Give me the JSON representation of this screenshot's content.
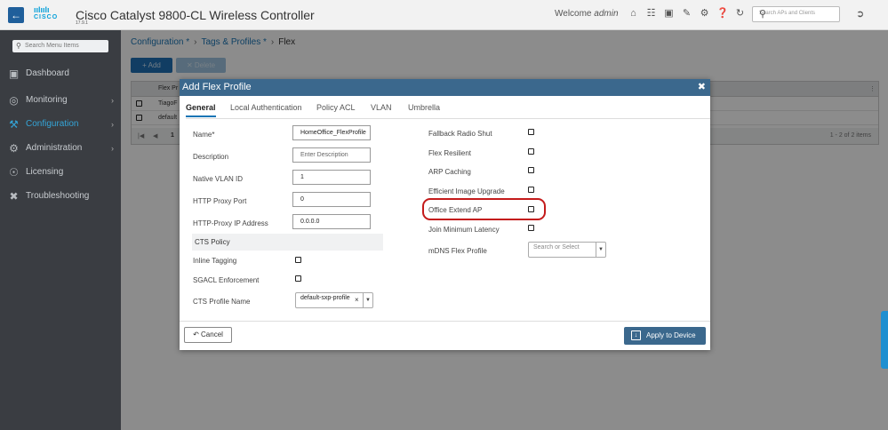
{
  "header": {
    "app_title": "Cisco Catalyst 9800-CL Wireless Controller",
    "version": "17.9.1",
    "logo_word": "CISCO",
    "welcome_prefix": "Welcome",
    "user": "admin",
    "search_placeholder": "Search APs and Clients",
    "icons": [
      "home-icon",
      "wireless-icon",
      "save-icon",
      "config-icon",
      "tools-icon",
      "help-icon",
      "refresh-icon"
    ]
  },
  "sidebar": {
    "search_placeholder": "Search Menu Items",
    "items": [
      {
        "label": "Dashboard",
        "icon": "dashboard-icon",
        "has_chevron": false,
        "active": false
      },
      {
        "label": "Monitoring",
        "icon": "monitoring-icon",
        "has_chevron": true,
        "active": false
      },
      {
        "label": "Configuration",
        "icon": "configuration-icon",
        "has_chevron": true,
        "active": true
      },
      {
        "label": "Administration",
        "icon": "administration-icon",
        "has_chevron": true,
        "active": false
      },
      {
        "label": "Licensing",
        "icon": "licensing-icon",
        "has_chevron": false,
        "active": false
      },
      {
        "label": "Troubleshooting",
        "icon": "troubleshooting-icon",
        "has_chevron": false,
        "active": false
      }
    ]
  },
  "breadcrumb": {
    "items": [
      "Configuration *",
      "Tags & Profiles *"
    ],
    "current": "Flex"
  },
  "toolbar": {
    "add_label": "Add",
    "delete_label": "Delete"
  },
  "grid": {
    "column_header": "Flex Pr",
    "rows": [
      "TiagoF",
      "default"
    ],
    "page_number": "1",
    "items_text": "1 - 2 of 2 items"
  },
  "modal": {
    "title": "Add Flex Profile",
    "tabs": [
      "General",
      "Local Authentication",
      "Policy ACL",
      "VLAN",
      "Umbrella"
    ],
    "active_tab": "General",
    "fields": {
      "name_label": "Name*",
      "name_value": "HomeOffice_FlexProfile",
      "description_label": "Description",
      "description_placeholder": "Enter Description",
      "native_vlan_label": "Native VLAN ID",
      "native_vlan_value": "1",
      "http_proxy_port_label": "HTTP Proxy Port",
      "http_proxy_port_value": "0",
      "http_proxy_ip_label": "HTTP-Proxy IP Address",
      "http_proxy_ip_value": "0.0.0.0"
    },
    "cts": {
      "section_title": "CTS Policy",
      "inline_tagging_label": "Inline Tagging",
      "sgacl_label": "SGACL Enforcement",
      "profile_name_label": "CTS Profile Name",
      "profile_name_value": "default-sxp-profile"
    },
    "right": {
      "fallback_radio_shut": "Fallback Radio Shut",
      "flex_resilient": "Flex Resilient",
      "arp_caching": "ARP Caching",
      "efficient_image_upgrade": "Efficient Image Upgrade",
      "office_extend_ap": "Office Extend AP",
      "join_min_latency": "Join Minimum Latency",
      "mdns_label": "mDNS Flex Profile",
      "mdns_placeholder": "Search or Select"
    },
    "cancel_label": "Cancel",
    "apply_label": "Apply to Device"
  },
  "colors": {
    "modal_header": "#3b688d",
    "sidebar_bg": "#3a3d42",
    "accent": "#1a75b5",
    "highlight_ring": "#c41b1b"
  }
}
